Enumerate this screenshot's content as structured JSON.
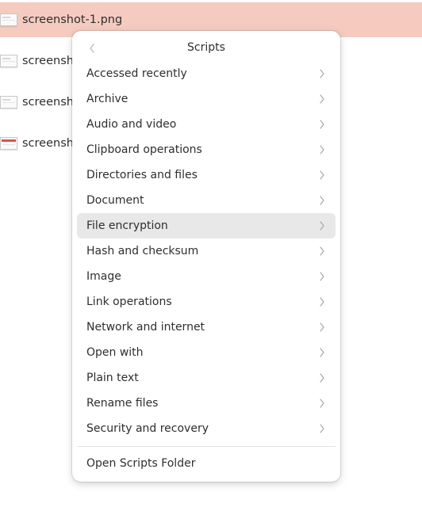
{
  "files": [
    {
      "name": "screenshot-1.png",
      "selected": true,
      "thumb": "plain"
    },
    {
      "name": "screensho",
      "selected": false,
      "thumb": "plain"
    },
    {
      "name": "screensho",
      "selected": false,
      "thumb": "plain"
    },
    {
      "name": "screensho",
      "selected": false,
      "thumb": "red"
    }
  ],
  "popover": {
    "title": "Scripts",
    "back_icon": "chevron-left-icon",
    "items": [
      {
        "label": "Accessed recently"
      },
      {
        "label": "Archive"
      },
      {
        "label": "Audio and video"
      },
      {
        "label": "Clipboard operations"
      },
      {
        "label": "Directories and files"
      },
      {
        "label": "Document"
      },
      {
        "label": "File encryption",
        "highlighted": true
      },
      {
        "label": "Hash and checksum"
      },
      {
        "label": "Image"
      },
      {
        "label": "Link operations"
      },
      {
        "label": "Network and internet"
      },
      {
        "label": "Open with"
      },
      {
        "label": "Plain text"
      },
      {
        "label": "Rename files"
      },
      {
        "label": "Security and recovery"
      }
    ],
    "footer_label": "Open Scripts Folder"
  },
  "colors": {
    "selection": "#f5cbc0",
    "hover": "#e8e8e8",
    "text": "#2e2e2e"
  }
}
